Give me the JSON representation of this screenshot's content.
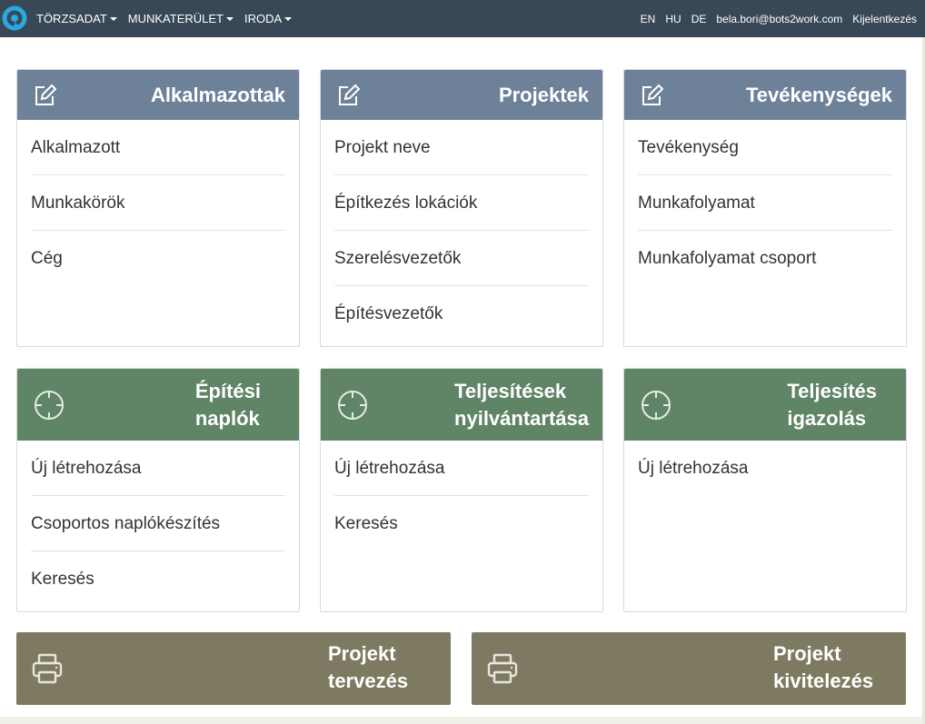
{
  "nav": {
    "menus": [
      "TÖRZSADAT",
      "MUNKATERÜLET",
      "IRODA"
    ],
    "languages": [
      "EN",
      "HU",
      "DE"
    ],
    "user_email": "bela.bori@bots2work.com",
    "logout": "Kijelentkezés"
  },
  "cards": {
    "employees": {
      "title": "Alkalmazottak",
      "items": [
        "Alkalmazott",
        "Munkakörök",
        "Cég"
      ]
    },
    "projects": {
      "title": "Projektek",
      "items": [
        "Projekt neve",
        "Építkezés lokációk",
        "Szerelésvezetők",
        "Építésvezetők"
      ]
    },
    "activities": {
      "title": "Tevékenységek",
      "items": [
        "Tevékenység",
        "Munkafolyamat",
        "Munkafolyamat csoport"
      ]
    },
    "construction_logs": {
      "title_line1": "Építési",
      "title_line2": "naplók",
      "items": [
        "Új létrehozása",
        "Csoportos naplókészítés",
        "Keresés"
      ]
    },
    "performance_records": {
      "title_line1": "Teljesítések",
      "title_line2": "nyilvántartása",
      "items": [
        "Új létrehozása",
        "Keresés"
      ]
    },
    "performance_certification": {
      "title_line1": "Teljesítés",
      "title_line2": "igazolás",
      "items": [
        "Új létrehozása"
      ]
    }
  },
  "wide": {
    "planning": {
      "line1": "Projekt",
      "line2": "tervezés"
    },
    "execution": {
      "line1": "Projekt",
      "line2": "kivitelezés"
    }
  },
  "colors": {
    "navbar": "#394857",
    "blue_header": "#6d8299",
    "green_header": "#5f8466",
    "olive_banner": "#7e7a62"
  },
  "icons": {
    "blue_cards": "edit-icon",
    "green_cards": "crosshair-icon",
    "banners": "printer-icon"
  }
}
